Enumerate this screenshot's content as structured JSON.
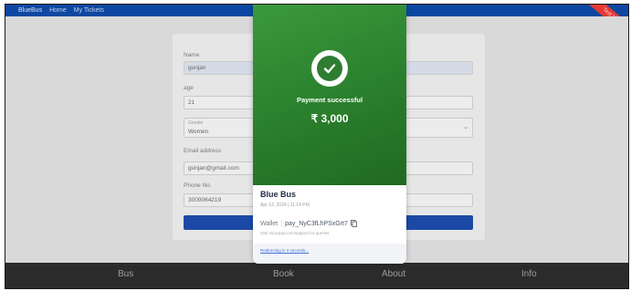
{
  "navbar": {
    "brand": "BlueBus",
    "links": [
      "Home",
      "My Tickets"
    ]
  },
  "test_mode_label": "Test Mode",
  "form": {
    "name_label": "Name",
    "name_value": "gunjan",
    "age_label": "age",
    "age_value": "21",
    "gender_label": "Gender",
    "gender_value": "Women",
    "email_label": "Email address",
    "email_value": "gunjan@gmail.com",
    "phone_label": "Phone No.",
    "phone_value": "3009064219"
  },
  "footer": {
    "tabs": [
      "Bus",
      "Book",
      "About",
      "Info"
    ]
  },
  "payment": {
    "status": "Payment successful",
    "amount": "₹ 3,000",
    "merchant": "Blue Bus",
    "date": "Apr 13, 2024 | 11:14 PM",
    "method": "Wallet",
    "payment_id": "pay_NyC3fLhPSxGrt7",
    "support_text": "Visit razorpay.com/support for queries",
    "redirect_text": "Redirecting in 3 seconds..."
  },
  "colors": {
    "navbar": "#0d47a1",
    "success_green": "#2e7d32",
    "footer": "#2b2b2b",
    "link_blue": "#3d6fd6"
  },
  "icons": {
    "success": "checkmark-icon",
    "copy": "copy-icon",
    "dropdown": "chevron-down-icon"
  }
}
